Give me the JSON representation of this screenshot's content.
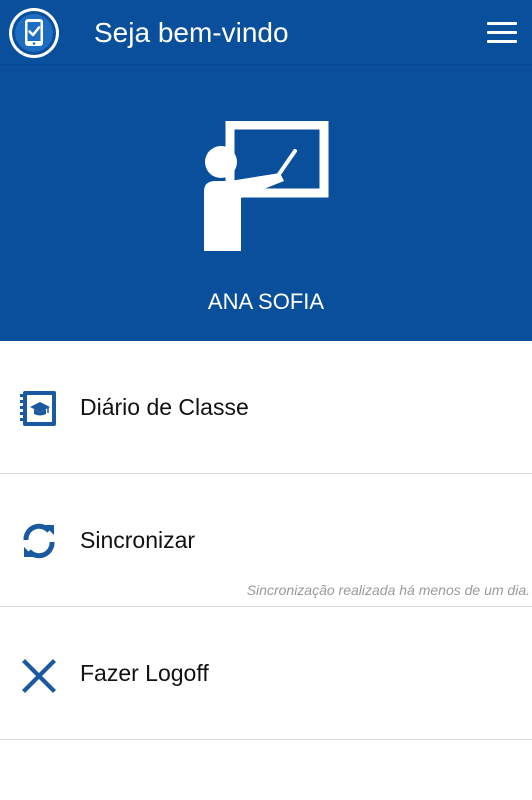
{
  "header": {
    "title": "Seja bem-vindo",
    "logo_icon": "tablet-check-icon",
    "menu_icon": "hamburger-menu-icon"
  },
  "profile": {
    "name": "ANA SOFIA",
    "illustration": "teacher-at-board-icon"
  },
  "menu": {
    "items": [
      {
        "label": "Diário de Classe",
        "icon": "class-diary-book-icon"
      },
      {
        "label": "Sincronizar",
        "icon": "sync-icon",
        "note": "Sincronização realizada há menos de um dia."
      },
      {
        "label": "Fazer Logoff",
        "icon": "close-x-icon"
      }
    ]
  },
  "colors": {
    "primary": "#0a4f9c",
    "icon_blue": "#1b5aa0",
    "note_gray": "#9a9a9a"
  }
}
